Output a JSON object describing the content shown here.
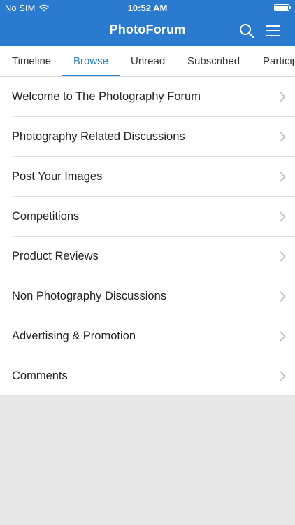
{
  "status": {
    "carrier": "No SIM",
    "time": "10:52 AM"
  },
  "appbar": {
    "title": "PhotoForum"
  },
  "tabs": [
    {
      "label": "Timeline"
    },
    {
      "label": "Browse"
    },
    {
      "label": "Unread"
    },
    {
      "label": "Subscribed"
    },
    {
      "label": "Participated"
    }
  ],
  "active_tab": "Browse",
  "forums": [
    {
      "label": "Welcome to The Photography Forum"
    },
    {
      "label": "Photography Related Discussions"
    },
    {
      "label": "Post Your Images"
    },
    {
      "label": "Competitions"
    },
    {
      "label": "Product Reviews"
    },
    {
      "label": "Non Photography Discussions"
    },
    {
      "label": "Advertising & Promotion"
    },
    {
      "label": "Comments"
    }
  ],
  "colors": {
    "accent": "#2a7bd0",
    "background": "#e8e8e8"
  },
  "icons": [
    "wifi-icon",
    "battery-icon",
    "search-icon",
    "menu-icon",
    "chevron-right-icon"
  ]
}
